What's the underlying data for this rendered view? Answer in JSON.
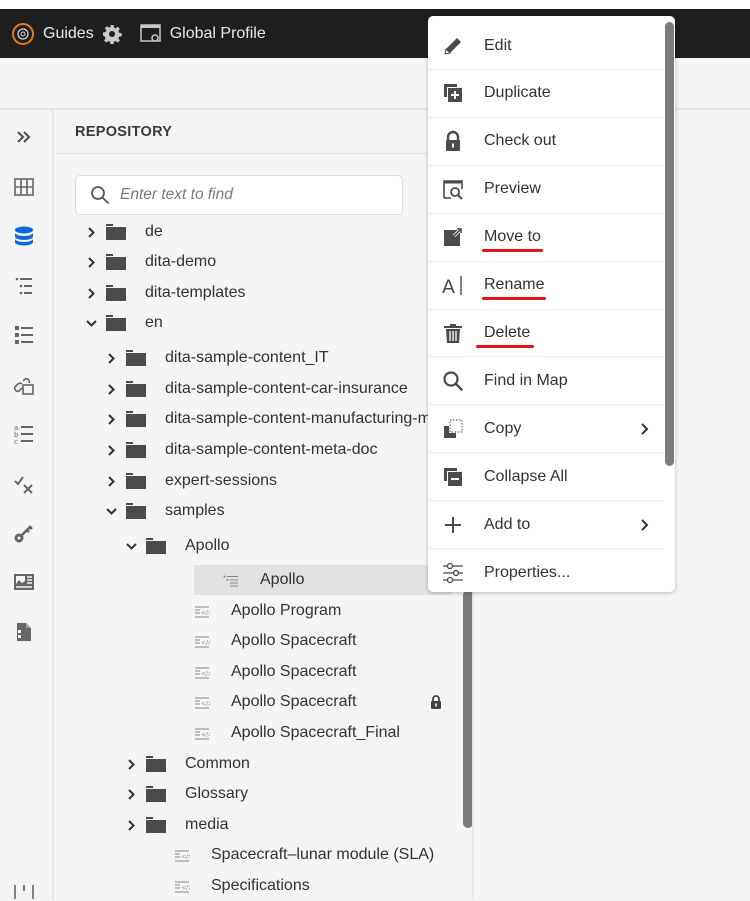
{
  "topbar": {
    "app_name": "Guides",
    "profile_label": "Global Profile",
    "icons": [
      "aem-guides-logo-icon",
      "settings-gear-icon",
      "profile-settings-icon"
    ]
  },
  "left_rail": {
    "icons": [
      "expand-chevrons-icon",
      "grid-icon",
      "repository-database-icon",
      "outline-list-icon",
      "bullet-list-icon",
      "link-reference-icon",
      "ordered-list-icon",
      "check-cross-icon",
      "key-icon",
      "image-card-icon",
      "document-panel-icon"
    ],
    "active": "repository-database-icon",
    "accent_color": "#1165d4"
  },
  "panel": {
    "title": "REPOSITORY",
    "search": {
      "placeholder": "Enter text to find",
      "value": ""
    },
    "tree": [
      {
        "label": "de",
        "type": "folder",
        "expanded": false,
        "level": 0
      },
      {
        "label": "dita-demo",
        "type": "folder",
        "expanded": false,
        "level": 0
      },
      {
        "label": "dita-templates",
        "type": "folder",
        "expanded": false,
        "level": 0
      },
      {
        "label": "en",
        "type": "folder",
        "expanded": true,
        "level": 0
      },
      {
        "label": "dita-sample-content_IT",
        "type": "folder",
        "expanded": false,
        "level": 1
      },
      {
        "label": "dita-sample-content-car-insurance",
        "type": "folder",
        "expanded": false,
        "level": 1
      },
      {
        "label": "dita-sample-content-manufacturing-m",
        "type": "folder",
        "expanded": false,
        "level": 1
      },
      {
        "label": "dita-sample-content-meta-doc",
        "type": "folder",
        "expanded": false,
        "level": 1
      },
      {
        "label": "expert-sessions",
        "type": "folder",
        "expanded": false,
        "level": 1
      },
      {
        "label": "samples",
        "type": "folder",
        "expanded": true,
        "level": 1
      },
      {
        "label": "Apollo",
        "type": "folder",
        "expanded": true,
        "level": 2
      },
      {
        "label": "Apollo",
        "type": "map",
        "level": 3,
        "selected": true
      },
      {
        "label": "Apollo Program",
        "type": "topic",
        "level": 3
      },
      {
        "label": "Apollo Spacecraft",
        "type": "topic",
        "level": 3
      },
      {
        "label": "Apollo Spacecraft",
        "type": "topic",
        "level": 3
      },
      {
        "label": "Apollo Spacecraft",
        "type": "topic",
        "level": 3,
        "locked": true
      },
      {
        "label": "Apollo Spacecraft_Final",
        "type": "topic",
        "level": 3
      },
      {
        "label": "Common",
        "type": "folder",
        "expanded": false,
        "level": 2
      },
      {
        "label": "Glossary",
        "type": "folder",
        "expanded": false,
        "level": 2
      },
      {
        "label": "media",
        "type": "folder",
        "expanded": false,
        "level": 2
      },
      {
        "label": "Spacecraft–lunar module (SLA)",
        "type": "topic",
        "level": 2
      },
      {
        "label": "Specifications",
        "type": "topic",
        "level": 2
      }
    ]
  },
  "context_menu": {
    "items": [
      {
        "label": "Edit",
        "icon": "pencil-icon"
      },
      {
        "label": "Duplicate",
        "icon": "duplicate-icon"
      },
      {
        "label": "Check out",
        "icon": "lock-icon"
      },
      {
        "label": "Preview",
        "icon": "preview-icon"
      },
      {
        "label": "Move to",
        "icon": "move-to-icon",
        "highlighted": true
      },
      {
        "label": "Rename",
        "icon": "rename-icon",
        "highlighted": true
      },
      {
        "label": "Delete",
        "icon": "trash-icon",
        "highlighted": true
      },
      {
        "label": "Find in Map",
        "icon": "magnifier-icon"
      },
      {
        "label": "Copy",
        "icon": "copy-icon",
        "submenu": true
      },
      {
        "label": "Collapse All",
        "icon": "collapse-all-icon"
      },
      {
        "label": "Add to",
        "icon": "plus-icon",
        "submenu": true
      },
      {
        "label": "Properties...",
        "icon": "sliders-icon"
      }
    ],
    "highlight_color": "#e01616"
  }
}
